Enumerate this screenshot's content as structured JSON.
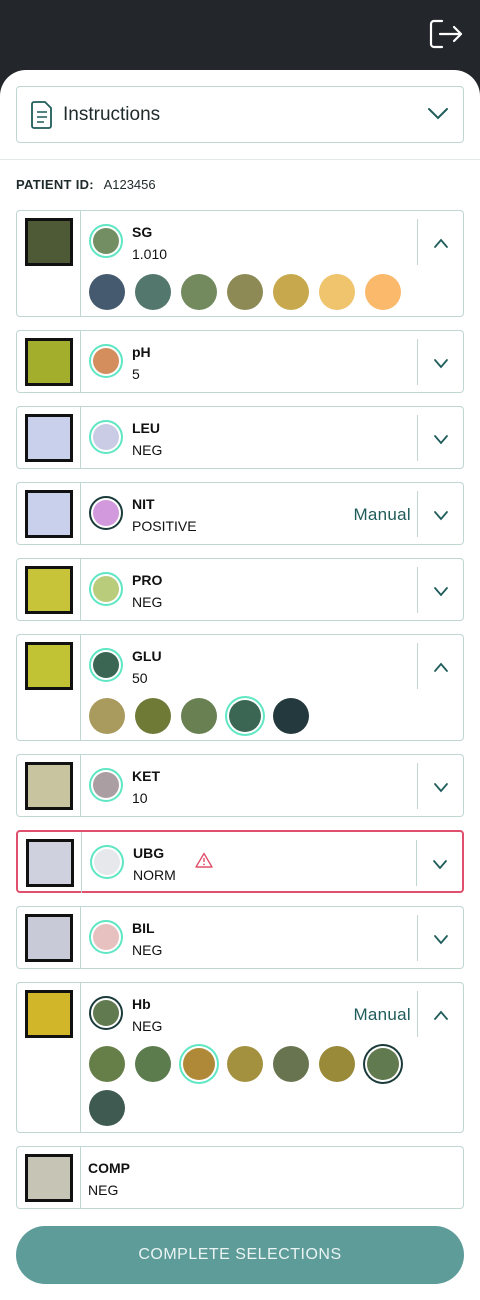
{
  "header": {
    "logout_icon": "logout-icon"
  },
  "instructions": {
    "label": "Instructions",
    "icon": "document-icon"
  },
  "patient": {
    "label": "PATIENT ID:",
    "value": "A123456"
  },
  "tests": [
    {
      "name": "SG",
      "value": "1.010",
      "expanded": true,
      "selected_color": "#748e63",
      "strip": "#4e5a36",
      "options": [
        "#455a6e",
        "#54776d",
        "#728a5e",
        "#8d8a56",
        "#c7a84c",
        "#efc46c",
        "#fbb96c"
      ]
    },
    {
      "name": "pH",
      "value": "5",
      "expanded": false,
      "selected_color": "#d48d5c",
      "strip": "#a3ae2c"
    },
    {
      "name": "LEU",
      "value": "NEG",
      "expanded": false,
      "selected_color": "#cacce6",
      "strip": "#c8d0ec"
    },
    {
      "name": "NIT",
      "value": "POSITIVE",
      "expanded": false,
      "manual": "Manual",
      "selected_color": "#d299dc",
      "strip": "#c8d0ec"
    },
    {
      "name": "PRO",
      "value": "NEG",
      "expanded": false,
      "selected_color": "#b9cc7c",
      "strip": "#c8c43a"
    },
    {
      "name": "GLU",
      "value": "50",
      "expanded": true,
      "selected_color": "#3b6653",
      "strip": "#c1c334",
      "options": [
        "#a99a5e",
        "#6f7a37",
        "#698053",
        "#3b6653",
        "#24393d"
      ]
    },
    {
      "name": "KET",
      "value": "10",
      "expanded": false,
      "selected_color": "#ab9ea2",
      "strip": "#c9c4a0"
    },
    {
      "name": "UBG",
      "value": "NORM",
      "expanded": false,
      "warning": true,
      "selected_color": "#e6e8ec",
      "strip": "#cfd1de"
    },
    {
      "name": "BIL",
      "value": "NEG",
      "expanded": false,
      "selected_color": "#e7c1c0",
      "strip": "#c8cad8"
    },
    {
      "name": "Hb",
      "value": "NEG",
      "expanded": true,
      "manual": "Manual",
      "selected_color": "#627a4f",
      "strip": "#d2b62a",
      "options": [
        "#667f48",
        "#5c7c4d",
        "#b08938",
        "#a3913f",
        "#687450",
        "#988a38",
        "#627a4f",
        "#3f5a50"
      ]
    },
    {
      "name": "COMP",
      "value": "NEG",
      "strip": "#c6c4b4"
    }
  ],
  "actions": {
    "complete_label": "COMPLETE SELECTIONS"
  }
}
